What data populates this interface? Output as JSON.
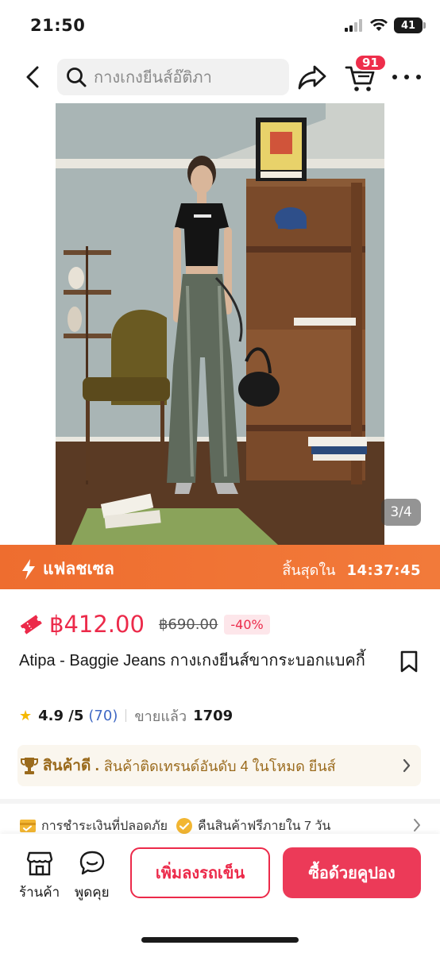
{
  "status_bar": {
    "time": "21:50",
    "battery": "41",
    "icons": [
      "signal-icon",
      "wifi-icon",
      "battery-icon"
    ]
  },
  "nav": {
    "search_placeholder": "กางเกงยีนส์อ๊ติภา",
    "cart_badge": "91",
    "icons": [
      "back-icon",
      "search-icon",
      "share-icon",
      "cart-icon",
      "more-icon"
    ]
  },
  "gallery": {
    "counter": "3/4"
  },
  "flash_sale": {
    "label": "แฟลชเซล",
    "ends_label": "สิ้นสุดใน",
    "countdown": "14:37:45"
  },
  "price": {
    "current": "฿412.00",
    "original": "฿690.00",
    "discount": "-40%"
  },
  "product": {
    "title": "Atipa - Baggie Jeans กางเกงยีนส์ขากระบอกแบคกี้"
  },
  "rating": {
    "score": "4.9 /5",
    "count": "(70)",
    "sold_label": "ขายแล้ว",
    "sold_count": "1709"
  },
  "good_product": {
    "label": "สินค้าดี .",
    "description": "สินค้าติดเทรนด์อันดับ 4 ในโหมด ยีนส์"
  },
  "assurance": {
    "items": [
      "การชำระเงินที่ปลอดภัย",
      "คืนสินค้าฟรีภายใน 7 วัน"
    ]
  },
  "bottom_bar": {
    "shop_label": "ร้านค้า",
    "chat_label": "พูดคุย",
    "add_to_cart": "เพิ่มลงรถเข็น",
    "buy_with_coupon": "ซื้อด้วยคูปอง"
  },
  "colors": {
    "accent": "#ec2a4a",
    "flash_orange": "#ee6d2f",
    "good_gold": "#9a6a1c",
    "rating_link": "#3f68c4"
  }
}
